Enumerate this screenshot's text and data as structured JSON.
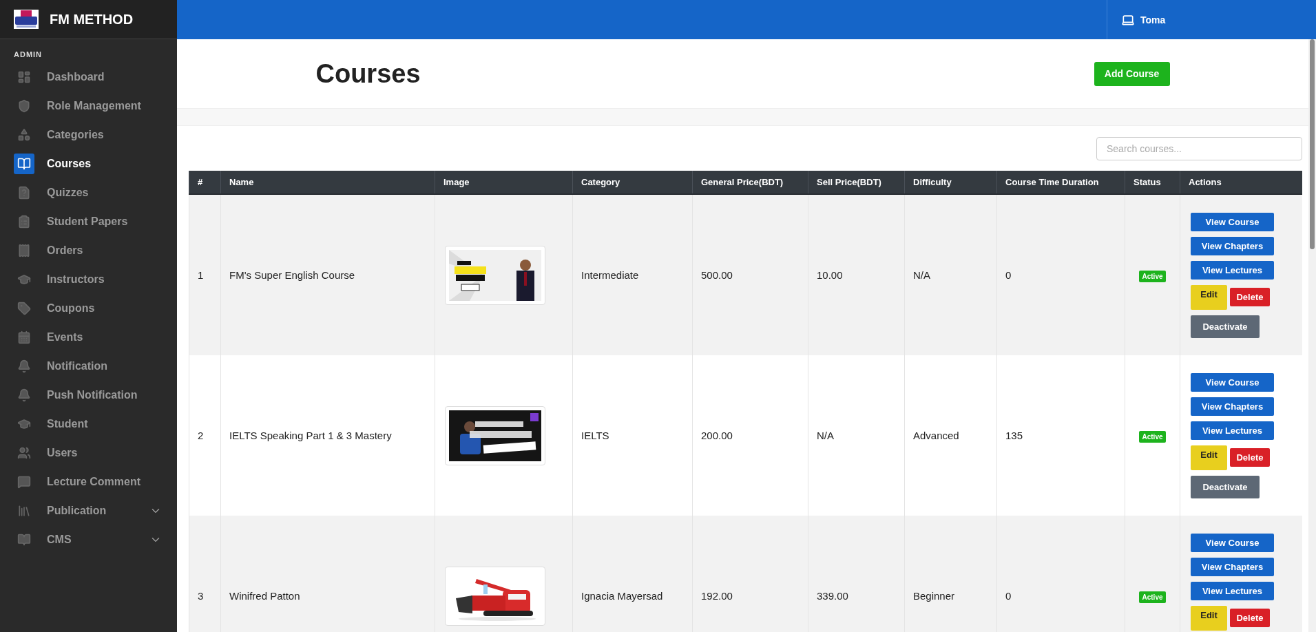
{
  "brand": {
    "name": "FM METHOD"
  },
  "sidebar": {
    "section": "ADMIN",
    "items": [
      {
        "label": "Dashboard",
        "selected": false
      },
      {
        "label": "Role Management",
        "selected": false
      },
      {
        "label": "Categories",
        "selected": false
      },
      {
        "label": "Courses",
        "selected": true
      },
      {
        "label": "Quizzes",
        "selected": false
      },
      {
        "label": "Student Papers",
        "selected": false
      },
      {
        "label": "Orders",
        "selected": false
      },
      {
        "label": "Instructors",
        "selected": false
      },
      {
        "label": "Coupons",
        "selected": false
      },
      {
        "label": "Events",
        "selected": false
      },
      {
        "label": "Notification",
        "selected": false
      },
      {
        "label": "Push Notification",
        "selected": false
      },
      {
        "label": "Student",
        "selected": false
      },
      {
        "label": "Users",
        "selected": false
      },
      {
        "label": "Lecture Comment",
        "selected": false
      },
      {
        "label": "Publication",
        "selected": false,
        "expanded": false
      },
      {
        "label": "CMS",
        "selected": false,
        "expanded": false
      }
    ]
  },
  "topbar": {
    "user": "Toma"
  },
  "page": {
    "title": "Courses",
    "add_button": "Add Course"
  },
  "search": {
    "placeholder": "Search courses..."
  },
  "table": {
    "columns": [
      "#",
      "Name",
      "Image",
      "Category",
      "General Price(BDT)",
      "Sell Price(BDT)",
      "Difficulty",
      "Course Time Duration",
      "Status",
      "Actions"
    ],
    "rows": [
      {
        "index": "1",
        "name": "FM's Super English Course",
        "image": {
          "kind": "picture"
        },
        "category": "Intermediate",
        "general_price": "500.00",
        "sell_price": "10.00",
        "difficulty": "N/A",
        "duration": "0",
        "status": "Active",
        "actions": [
          "View Course",
          "View Chapters",
          "View Lectures",
          "Edit",
          "Delete",
          "Deactivate"
        ]
      },
      {
        "index": "2",
        "name": "IELTS Speaking Part 1 & 3 Mastery",
        "image": {
          "kind": "picture"
        },
        "category": "IELTS",
        "general_price": "200.00",
        "sell_price": "N/A",
        "difficulty": "Advanced",
        "duration": "135",
        "status": "Active",
        "actions": [
          "View Course",
          "View Chapters",
          "View Lectures",
          "Edit",
          "Delete",
          "Deactivate"
        ]
      },
      {
        "index": "3",
        "name": "Winifred Patton",
        "image": {
          "kind": "picture"
        },
        "category": "Ignacia Mayersad",
        "general_price": "192.00",
        "sell_price": "339.00",
        "difficulty": "Beginner",
        "duration": "0",
        "status": "Active",
        "actions": [
          "View Course",
          "View Chapters",
          "View Lectures",
          "Edit",
          "Delete"
        ]
      }
    ]
  }
}
